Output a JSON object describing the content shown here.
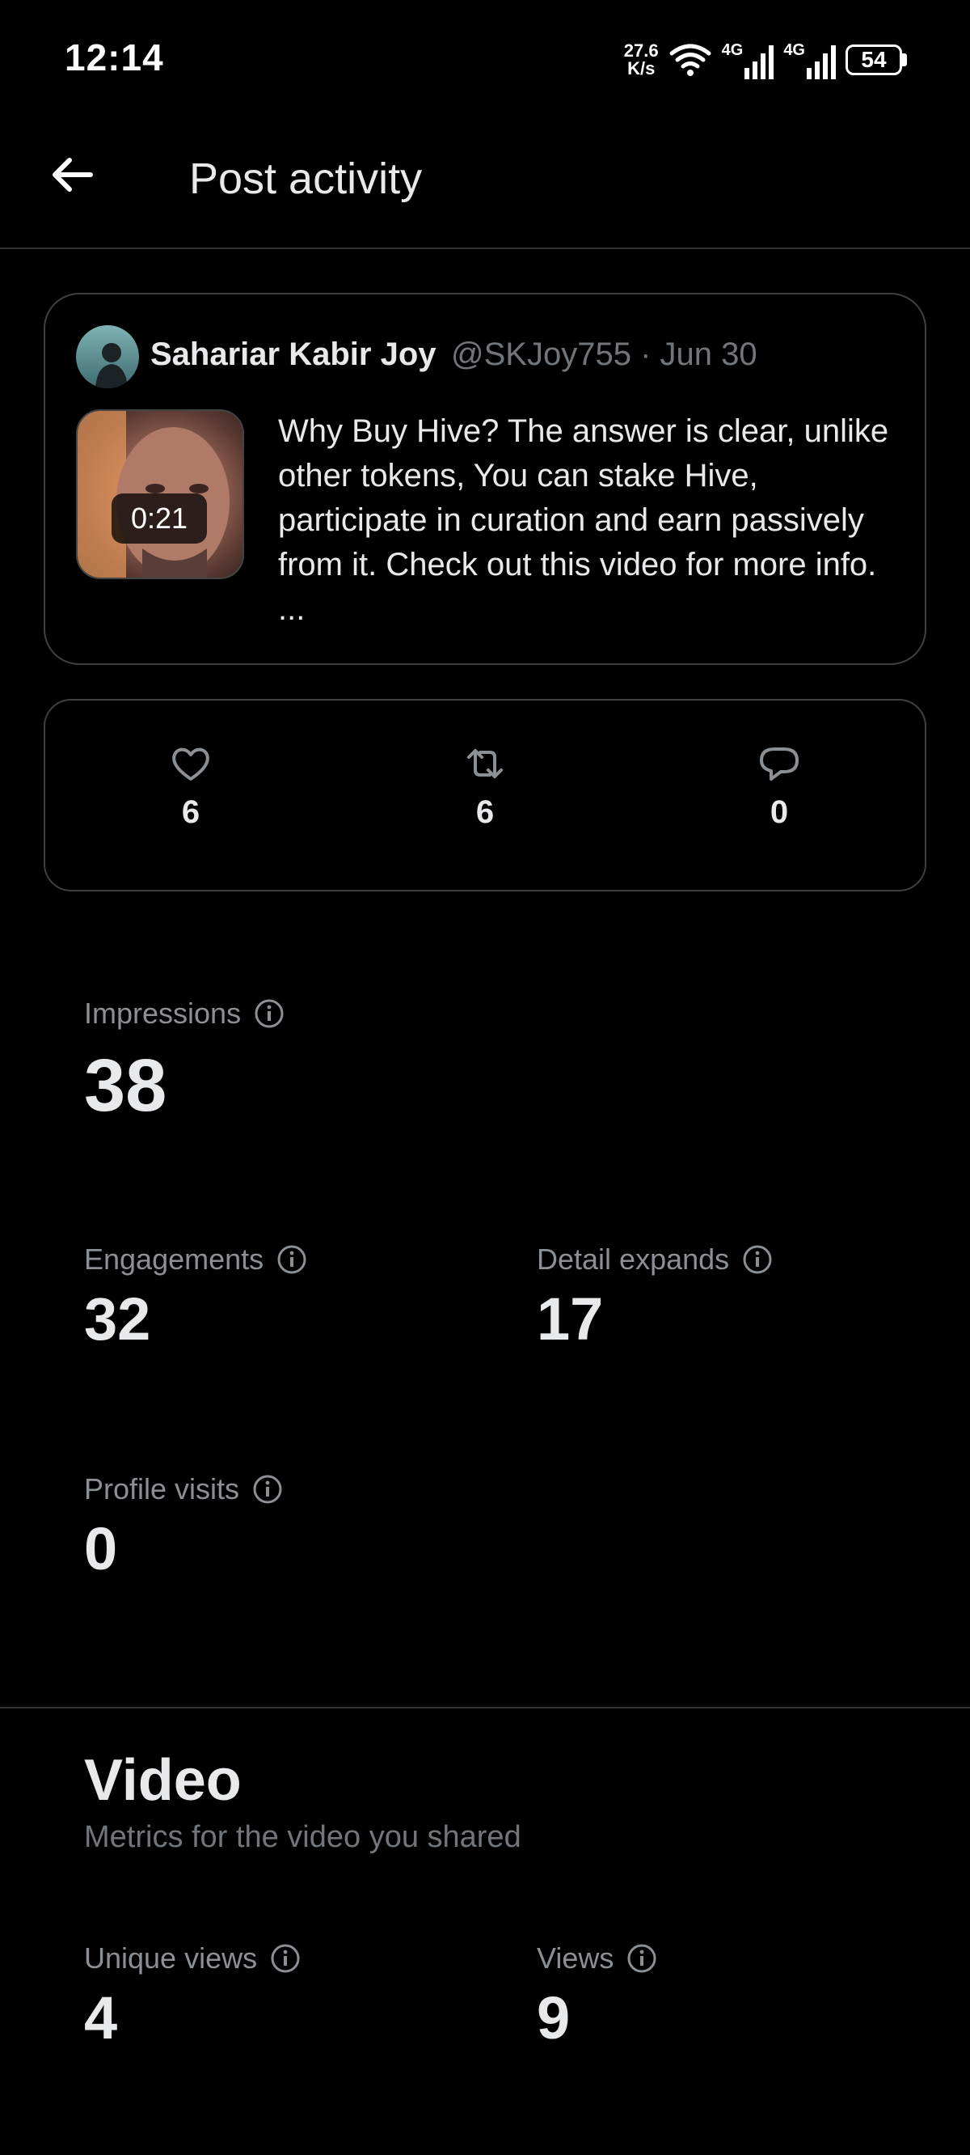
{
  "status_bar": {
    "time": "12:14",
    "net_speed_value": "27.6",
    "net_speed_unit": "K/s",
    "network_1": "4G",
    "network_2": "4G",
    "battery": "54"
  },
  "header": {
    "title": "Post activity"
  },
  "post": {
    "author_name": "Sahariar Kabir Joy",
    "author_meta": "@SKJoy755 · Jun 30",
    "video_duration": "0:21",
    "text": "Why Buy Hive? The answer is clear, unlike other tokens, You can stake Hive, participate in curation and earn passively from it. Check out this video for more info. ..."
  },
  "engagement": {
    "likes": "6",
    "reposts": "6",
    "replies": "0"
  },
  "metrics": {
    "impressions_label": "Impressions",
    "impressions_value": "38",
    "engagements_label": "Engagements",
    "engagements_value": "32",
    "detail_expands_label": "Detail expands",
    "detail_expands_value": "17",
    "profile_visits_label": "Profile visits",
    "profile_visits_value": "0"
  },
  "video": {
    "title": "Video",
    "subtitle": "Metrics for the video you shared",
    "unique_views_label": "Unique views",
    "unique_views_value": "4",
    "views_label": "Views",
    "views_value": "9"
  },
  "colors": {
    "background": "#000000",
    "text_primary": "#e7e9ea",
    "text_secondary": "#71767b",
    "border": "#3e4144"
  }
}
